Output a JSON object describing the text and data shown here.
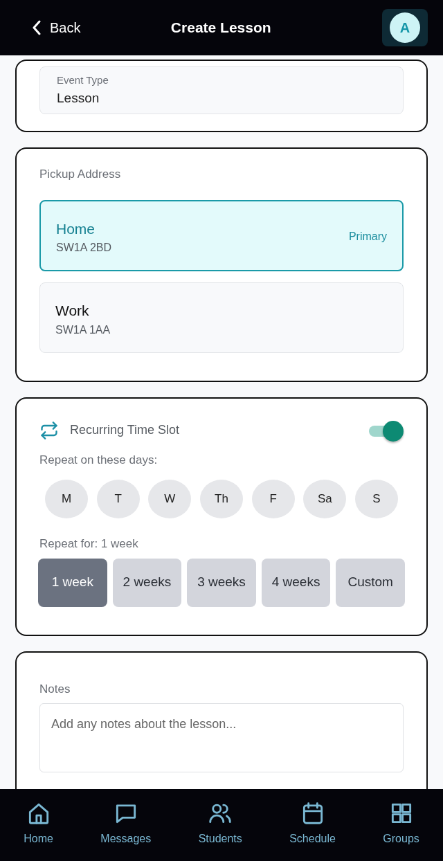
{
  "header": {
    "back": "Back",
    "title": "Create Lesson",
    "avatar": "A"
  },
  "event_type": {
    "label": "Event Type",
    "value": "Lesson"
  },
  "pickup": {
    "label": "Pickup Address",
    "addresses": [
      {
        "name": "Home",
        "postcode": "SW1A 2BD",
        "badge": "Primary",
        "selected": true
      },
      {
        "name": "Work",
        "postcode": "SW1A 1AA",
        "selected": false
      }
    ]
  },
  "recurring": {
    "title": "Recurring Time Slot",
    "on": true,
    "days_label": "Repeat on these days:",
    "days": [
      {
        "label": "M",
        "selected": false
      },
      {
        "label": "T",
        "selected": false
      },
      {
        "label": "W",
        "selected": false
      },
      {
        "label": "Th",
        "selected": false
      },
      {
        "label": "F",
        "selected": false
      },
      {
        "label": "Sa",
        "selected": false
      },
      {
        "label": "S",
        "selected": false
      }
    ],
    "repeat_label": "Repeat for: 1 week",
    "durations": [
      {
        "label": "1 week",
        "selected": true
      },
      {
        "label": "2 weeks",
        "selected": false
      },
      {
        "label": "3 weeks",
        "selected": false
      },
      {
        "label": "4 weeks",
        "selected": false
      },
      {
        "label": "Custom",
        "selected": false
      }
    ]
  },
  "notes": {
    "label": "Notes",
    "placeholder": "Add any notes about the lesson..."
  },
  "bottom_nav": [
    {
      "label": "Home"
    },
    {
      "label": "Messages"
    },
    {
      "label": "Students"
    },
    {
      "label": "Schedule"
    },
    {
      "label": "Groups"
    }
  ]
}
